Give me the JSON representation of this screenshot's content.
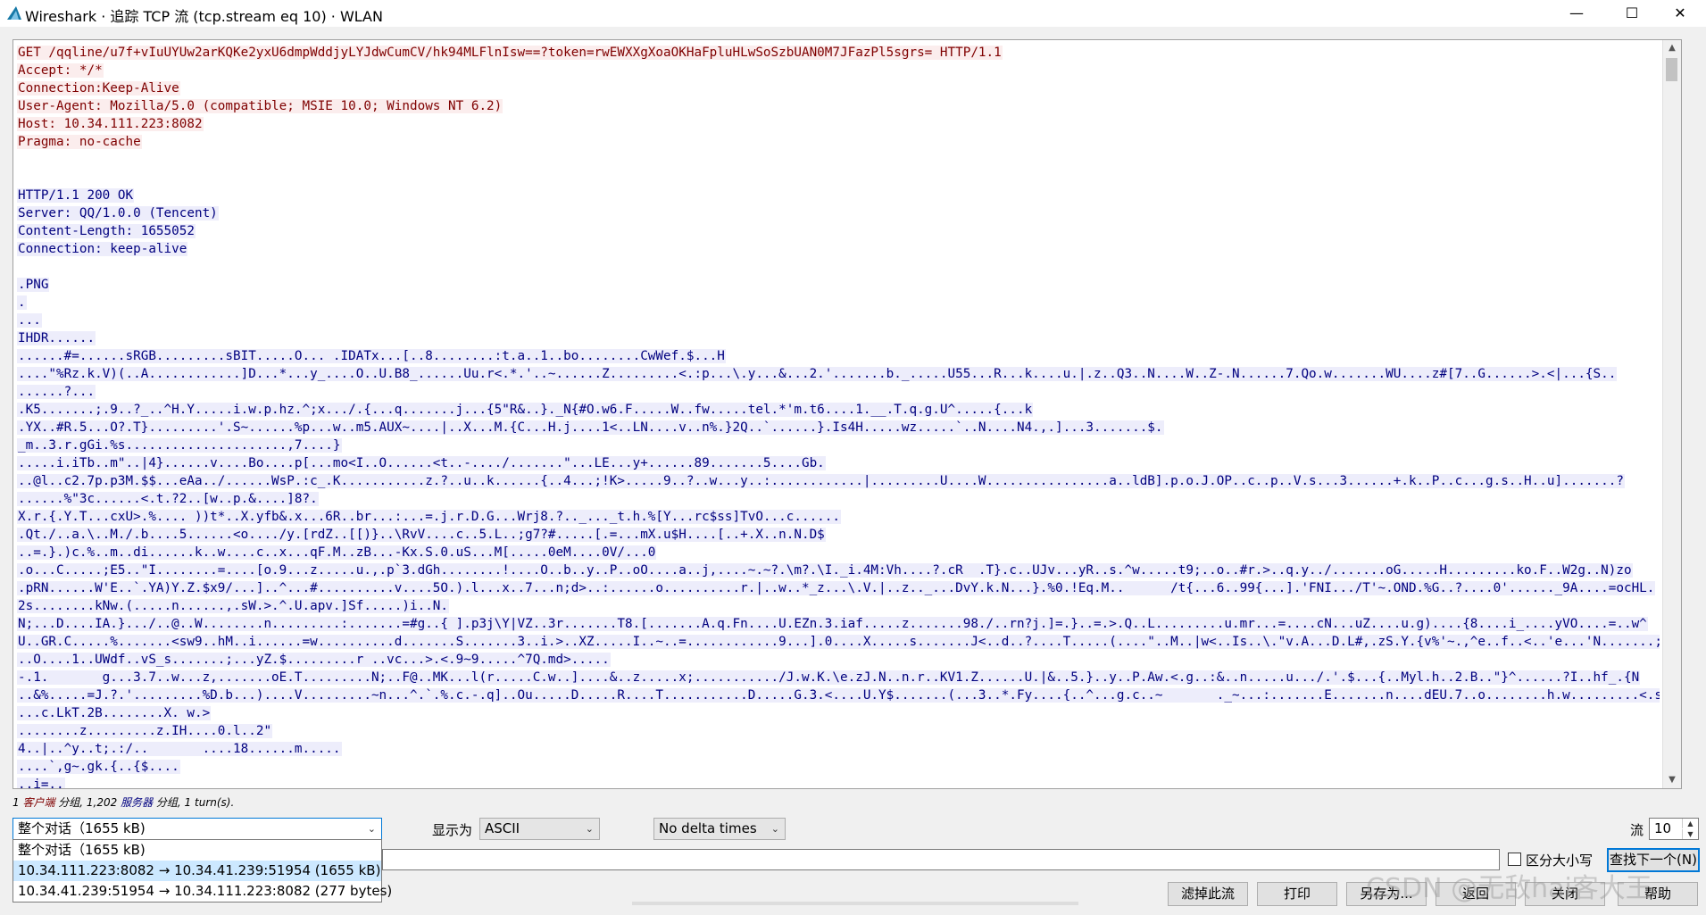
{
  "window": {
    "title": "Wireshark · 追踪 TCP 流 (tcp.stream eq 10) · WLAN",
    "minimize_glyph": "—",
    "maximize_glyph": "☐",
    "close_glyph": "✕",
    "icon": "wireshark-fin-icon"
  },
  "stream": {
    "lines": [
      {
        "dir": "client",
        "text": "GET /qqline/u7f+vIuUYUw2arKQKe2yxU6dmpWddjyLYJdwCumCV/hk94MLFlnIsw==?token=rwEWXXgXoaOKHaFpluHLwSoSzbUAN0M7JFazPl5sgrs= HTTP/1.1"
      },
      {
        "dir": "client",
        "text": "Accept: */*"
      },
      {
        "dir": "client",
        "text": "Connection:Keep-Alive"
      },
      {
        "dir": "client",
        "text": "User-Agent: Mozilla/5.0 (compatible; MSIE 10.0; Windows NT 6.2)"
      },
      {
        "dir": "client",
        "text": "Host: 10.34.111.223:8082"
      },
      {
        "dir": "client",
        "text": "Pragma: no-cache"
      },
      {
        "dir": "none",
        "text": ""
      },
      {
        "dir": "none",
        "text": ""
      },
      {
        "dir": "server",
        "text": "HTTP/1.1 200 OK"
      },
      {
        "dir": "server",
        "text": "Server: QQ/1.0.0 (Tencent)"
      },
      {
        "dir": "server",
        "text": "Content-Length: 1655052"
      },
      {
        "dir": "server",
        "text": "Connection: keep-alive"
      },
      {
        "dir": "none",
        "text": ""
      },
      {
        "dir": "server",
        "text": ".PNG"
      },
      {
        "dir": "server",
        "text": "."
      },
      {
        "dir": "server",
        "text": "..."
      },
      {
        "dir": "server",
        "text": "IHDR......"
      },
      {
        "dir": "server",
        "text": "......#=......sRGB.........sBIT.....O... .IDATx...[..8........:t.a..1..bo........CwWef.$...H"
      },
      {
        "dir": "server",
        "text": "....\"%Rz.k.V)(..A............]D...*...y_....O..U.B8_......Uu.r<.*.'..~......Z.........<.:p...\\.y...&...2.'.......b._.....U55...R...k....u.|.z..Q3..N....W..Z-.N......7.Qo.w.......WU....z#[7..G......>.<|...{S.."
      },
      {
        "dir": "server",
        "text": "......?..."
      },
      {
        "dir": "server",
        "text": ".K5.......;.9..?_..^H.Y.....i.w.p.hz.^;x.../.{...q.......j...{5\"R&..}._N{#O.w6.F.....W..fw.....tel.*'m.t6....1.__.T.q.g.U^.....{...k"
      },
      {
        "dir": "server",
        "text": ".YX..#R.5...O?.T}.........'.S~......%p...w..m5.AUX~....|..X...M.{C...H.j....1<..LN....v..n%.}2Q..`......}.Is4H.....wz.....`..N....N4.,.]...3.......$."
      },
      {
        "dir": "server",
        "text": "_m..3.r.gGi.%s.....................,7....}"
      },
      {
        "dir": "server",
        "text": ".....i.iTb..m\"..|4}......v....Bo....p[...mo<I..O......<t..-..../.......\"...LE...y+......89.......5....Gb."
      },
      {
        "dir": "server",
        "text": "..@l..c2.7p.p3M.$$...eAa../......WsP.:c_.K...........z.?..u..k......{..4...;!K>.....9..?..w...y..:............|.........U....W................a..ldB].p.o.J.OP..c..p..V.s...3......+.k..P..c...g.s..H..u].......?"
      },
      {
        "dir": "server",
        "text": "......%\"3c......<.t.?2..[w..p.&....]8?."
      },
      {
        "dir": "server",
        "text": "X.r.{.Y.T...cxU>.%.... ))t*..X.yfb&.x...6R..br...:...=.j.r.D.G...Wrj8.?.._..._t.h.%[Y...rc$ss]TvO...c......"
      },
      {
        "dir": "server",
        "text": ".Qt./..a.\\..M./.b....5......<o..../y.[rdZ..[[)}..\\RvV....c..5.L..;g7?#.....[.=...mX.u$H....[..+.X..n.N.D$"
      },
      {
        "dir": "server",
        "text": "..=.}.)c.%..m..di......k..w....c..x...qF.M..zB...-Kx.S.0.uS...M[.....0eM....0V/...0"
      },
      {
        "dir": "server",
        "text": ".o...C.....;E5..\"I........=....[o.9...z.....u.,.p`3.dGh........!....O..b..y..P..oO....a..j,....~.~?.\\m?.\\I._i.4M:Vh....?.cR  .T}.c..UJv...yR..s.^w.....t9;..o..#r.>..q.y../.......oG.....H.........ko.F..W2g..N)zo"
      },
      {
        "dir": "server",
        "text": ".pRN......W'E..`.YA)Y.Z.$x9/...]..^...#..........v....5O.).l...x..7...n;d>..:......o..........r.|..w..*_z...\\.V.|..z.._...DvY.k.N...}.%0.!Eq.M..      /t{...6..99{...].'FNI.../T'~.OND.%G..?....0'......_9A....=ocHL."
      },
      {
        "dir": "server",
        "text": "2s........kNw.(.....n......,.sW.>.^.U.apv.]Sf.....)i..N."
      },
      {
        "dir": "server",
        "text": "N;...D....IA.}.../..@..W........n.........:.......=#g..{ ].p3j\\Y|VZ..3r.......T8.[.......A.q.Fn....U.EZn.3.iaf.....z.......98./..rn?j.]=.}..=.>.Q..L.........u.mr...=....cN...uZ....u.g)....{8....i_....yVO....=..w^"
      },
      {
        "dir": "server",
        "text": "U..GR.C.....%.......<sw9..hM..i......=w..........d.......S.......3..i.>..XZ.....I..~..=............9...].0....X.....s.......J<..d..?....T.....(....\"..M..|w<..Is..\\.\"v.A...D.L#,.zS.Y.{v%'~.,^e..f..<..'e...'N.......;"
      },
      {
        "dir": "server",
        "text": "..O....1..UWdf..vS_s.......;...yZ.$.........r ..vc...>.<.9~9.....^7Q.md>....."
      },
      {
        "dir": "server",
        "text": "-.1.       g...3.7..w...z,.......oE.T.........N;..F@..MK...l(r.....C.w..]....&..z.....x;.........../J.w.K.\\e.zJ.N..n.r..KV1.Z......U.|&..5.}..y..P.Aw.<.g..:&..n.....u.../.'.$...{..Myl.h..2.B..\"}^......?I..hf_.{N"
      },
      {
        "dir": "server",
        "text": "..&%.....=J.?.'.........%D.b...)....V.........~n...^.`.%.c.-.q]..Ou.....D.....R....T...........D.....G.3.<....U.Y$.......(...3..*.Fy....{..^...g.c..~       ._~...:.......E.......n....dEU.7..o........h.w.........<.s......!."
      },
      {
        "dir": "server",
        "text": "...c.LkT.2B........X. w.>"
      },
      {
        "dir": "server",
        "text": "........z.........z.IH....0.l..2\""
      },
      {
        "dir": "server",
        "text": "4..|..^y..t;.:/..       ....18......m....."
      },
      {
        "dir": "server",
        "text": "....`,g~.gk.{..{$...."
      },
      {
        "dir": "server",
        "text": "..i=.."
      }
    ]
  },
  "summary": {
    "prefix": "1 ",
    "client_word": "客户端",
    "middle": " 分组, 1,202 ",
    "server_word": "服务器",
    "suffix": " 分组, 1 turn(s)."
  },
  "controls": {
    "conversation_selected": "整个对话（1655 kB)",
    "conversation_options": [
      "整个对话（1655 kB)",
      "10.34.111.223:8082 → 10.34.41.239:51954 (1655 kB)",
      "10.34.41.239:51954 → 10.34.111.223:8082 (277 bytes)"
    ],
    "show_as_label": "显示为",
    "show_as_value": "ASCII",
    "delta_value": "No delta times",
    "stream_label": "流",
    "stream_value": "10",
    "find_value": "",
    "case_sensitive_label": "区分大小写",
    "find_next_label": "查找下一个(N)"
  },
  "buttons": {
    "filter_out": "滤掉此流",
    "print": "打印",
    "save_as": "另存为...",
    "back": "返回",
    "close": "关闭",
    "help": "帮助"
  },
  "watermark": "CSDN @无敌hai客大王"
}
